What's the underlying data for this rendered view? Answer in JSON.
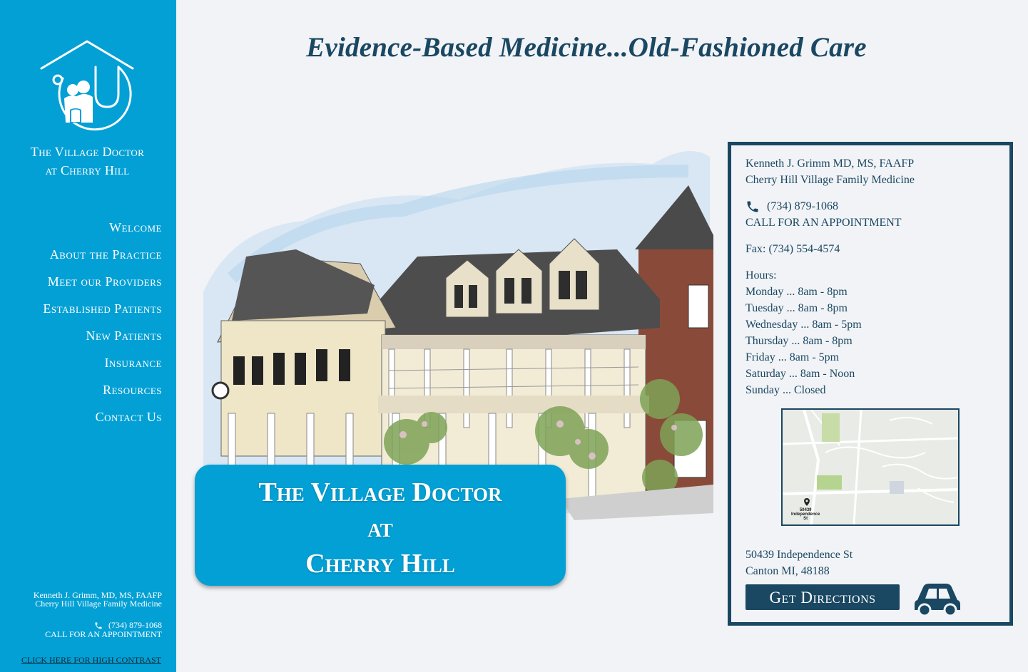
{
  "site": {
    "title_line1": "The Village Doctor",
    "title_line2": "at Cherry Hill"
  },
  "nav": {
    "items": [
      {
        "label": "Welcome"
      },
      {
        "label": "About the Practice"
      },
      {
        "label": "Meet our Providers"
      },
      {
        "label": "Established Patients"
      },
      {
        "label": "New Patients"
      },
      {
        "label": "Insurance"
      },
      {
        "label": "Resources"
      },
      {
        "label": "Contact Us"
      }
    ]
  },
  "sidebar_contact": {
    "doctor": "Kenneth J. Grimm, MD, MS, FAAFP",
    "practice": "Cherry Hill Village Family Medicine",
    "phone": "(734) 879-1068",
    "cta": "CALL FOR AN APPOINTMENT",
    "contrast_link": "CLICK HERE FOR HIGH CONTRAST"
  },
  "headline": "Evidence-Based Medicine...Old-Fashioned Care",
  "hero": {
    "badge_line1": "The Village Doctor",
    "badge_line2": "at",
    "badge_line3": "Cherry Hill"
  },
  "info": {
    "doctor": "Kenneth J. Grimm MD, MS, FAAFP",
    "practice": "Cherry Hill Village Family Medicine",
    "phone": "(734) 879-1068",
    "cta": "CALL FOR AN APPOINTMENT",
    "fax": "Fax: (734) 554-4574",
    "hours_label": "Hours:",
    "hours": [
      "Monday ... 8am - 8pm",
      "Tuesday ... 8am - 8pm",
      "Wednesday ... 8am - 5pm",
      "Thursday ... 8am - 8pm",
      "Friday ... 8am - 5pm",
      "Saturday ... 8am - Noon",
      "Sunday ... Closed"
    ],
    "map_label_line1": "50439",
    "map_label_line2": "Independence",
    "map_label_line3": "St",
    "address_line1": "50439 Independence St",
    "address_line2": "Canton MI, 48188",
    "directions_label": "Get Directions"
  },
  "icons": {
    "logo": "house-family-stethoscope-logo",
    "phone": "phone-icon",
    "car": "car-icon",
    "map_pin": "map-pin-icon"
  },
  "colors": {
    "sidebar": "#03a0d5",
    "navy": "#1a4762",
    "background": "#f1f3f6"
  }
}
